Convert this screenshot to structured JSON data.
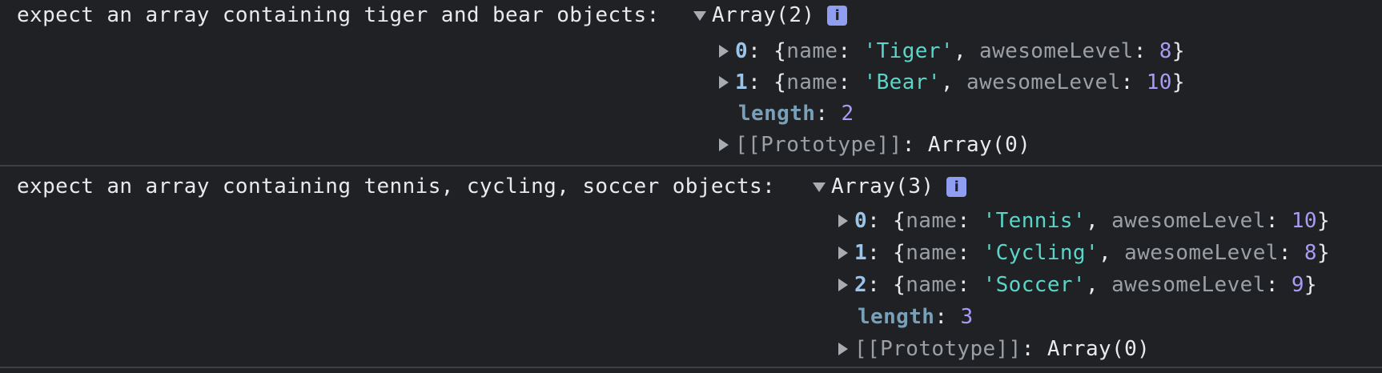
{
  "messages": [
    {
      "text": "expect an array containing tiger and bear objects:",
      "array_label": "Array(2)",
      "info_icon": "i",
      "items": [
        {
          "index": "0",
          "name": "'Tiger'",
          "level": "8"
        },
        {
          "index": "1",
          "name": "'Bear'",
          "level": "10"
        }
      ],
      "length_key": "length",
      "length_value": "2",
      "prototype_key": "[[Prototype]]",
      "prototype_value": "Array(0)"
    },
    {
      "text": "expect an array containing tennis, cycling, soccer objects:",
      "array_label": "Array(3)",
      "info_icon": "i",
      "items": [
        {
          "index": "0",
          "name": "'Tennis'",
          "level": "10"
        },
        {
          "index": "1",
          "name": "'Cycling'",
          "level": "8"
        },
        {
          "index": "2",
          "name": "'Soccer'",
          "level": "9"
        }
      ],
      "length_key": "length",
      "length_value": "3",
      "prototype_key": "[[Prototype]]",
      "prototype_value": "Array(0)"
    }
  ],
  "labels": {
    "open_brace": "{",
    "close_brace": "}",
    "name_key": "name",
    "level_key": "awesomeLevel",
    "colon": ": ",
    "comma": ", "
  },
  "colors": {
    "background": "#202124",
    "text": "#e8eaed",
    "index": "#9ac4ea",
    "key": "#9aa0a6",
    "string": "#5cd5c8",
    "number": "#a99bf5",
    "info_badge": "#8f9ef0"
  }
}
